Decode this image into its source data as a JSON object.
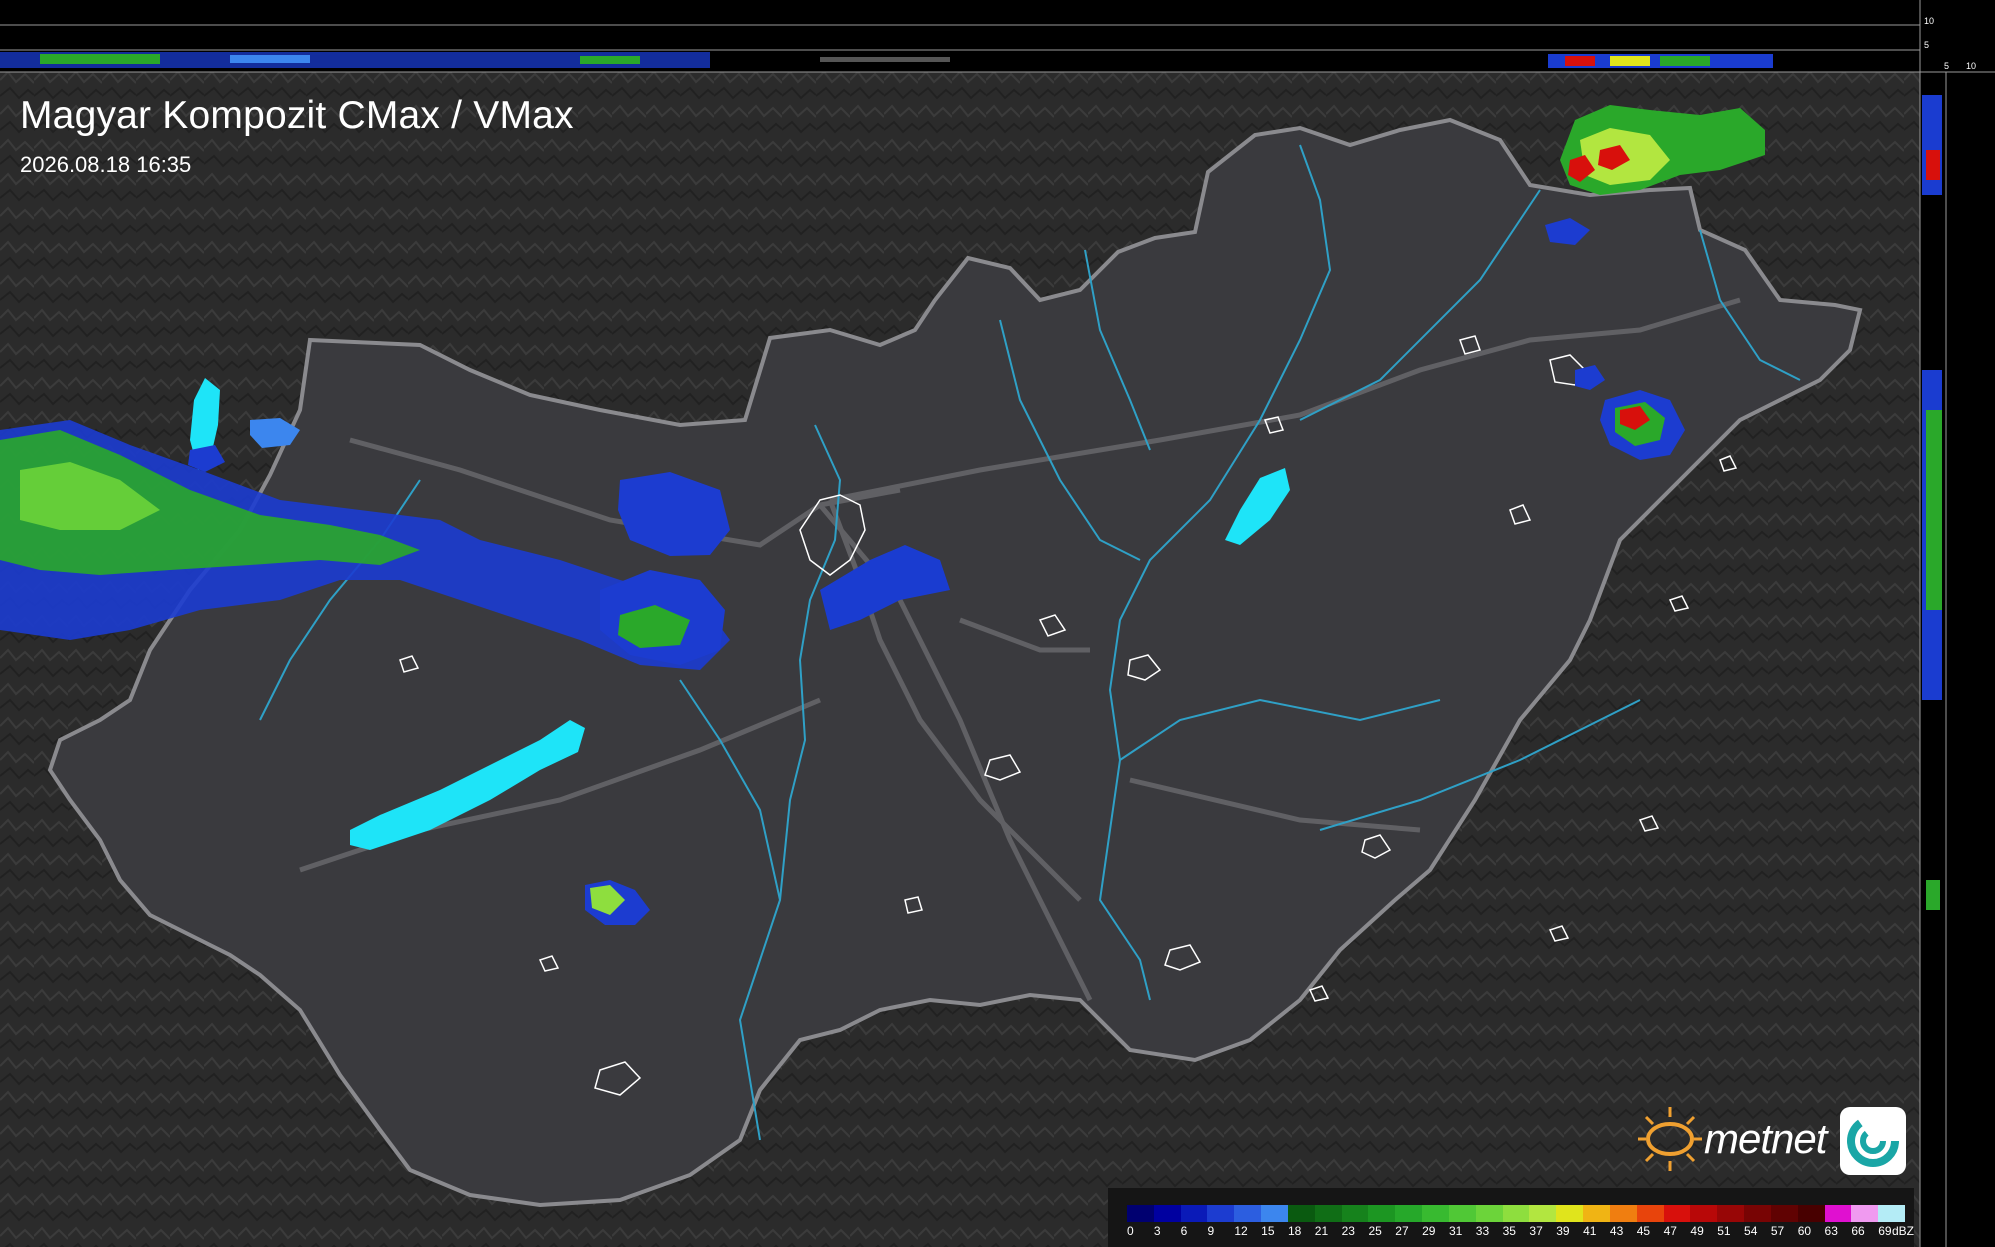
{
  "map": {
    "title": "Magyar Kompozit CMax / VMax",
    "timestamp": "2026.08.18 16:35",
    "brand": "metnet"
  },
  "legend": {
    "unit": "dBZ",
    "values": [
      "0",
      "3",
      "6",
      "9",
      "12",
      "15",
      "18",
      "21",
      "23",
      "25",
      "27",
      "29",
      "31",
      "33",
      "35",
      "37",
      "39",
      "41",
      "43",
      "45",
      "47",
      "49",
      "51",
      "54",
      "57",
      "60",
      "63",
      "66",
      "69"
    ],
    "colors": [
      "#000070",
      "#0000a0",
      "#0a1ab8",
      "#1c3cd0",
      "#2c5ee0",
      "#3c86ee",
      "#0a5a10",
      "#106e16",
      "#16821c",
      "#1c9622",
      "#26a82a",
      "#38ba30",
      "#50c836",
      "#6cd43a",
      "#8ede3e",
      "#b2e640",
      "#e0e41c",
      "#f0b414",
      "#f07e10",
      "#e8440c",
      "#d8100c",
      "#b80808",
      "#980606",
      "#780404",
      "#600202",
      "#480000",
      "#e010d0",
      "#f09af0",
      "#b4ecf6"
    ]
  },
  "side_profile": {
    "ticks": [
      "10",
      "5",
      "5",
      "10"
    ]
  },
  "colors": {
    "background": "#2b2b2b",
    "country_fill": "#3a3a3e",
    "border_line": "#8a8a8e",
    "rivers": "#2fa0c6",
    "lakes": "#1ee4f8",
    "brand_orange": "#f0a030",
    "brand_teal": "#1aa6a6"
  }
}
